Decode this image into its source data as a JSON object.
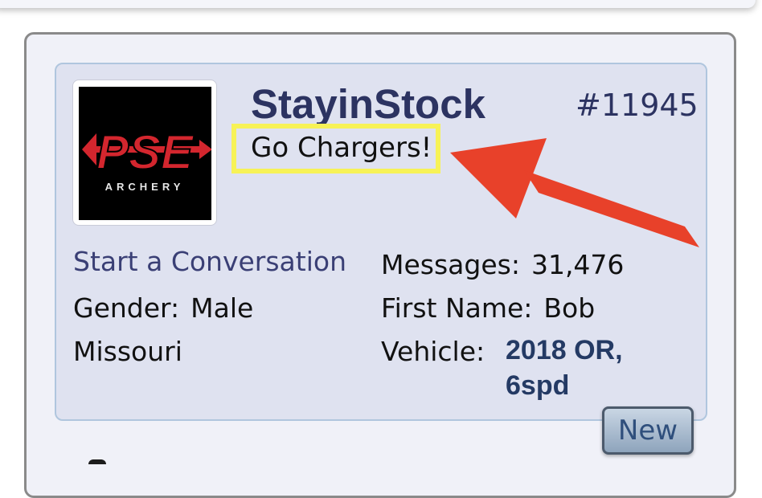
{
  "profile": {
    "username": "StayinStock",
    "user_number": "#11945",
    "status": "Go Chargers!",
    "start_conversation": "Start a Conversation",
    "gender_label": "Gender:",
    "gender_value": "Male",
    "location": "Missouri",
    "messages_label": "Messages:",
    "messages_value": "31,476",
    "first_name_label": "First Name:",
    "first_name_value": "Bob",
    "vehicle_label": "Vehicle:",
    "vehicle_value": "2018 OR, 6spd",
    "new_badge": "New"
  },
  "avatar": {
    "brand_text": "PSE",
    "sub_text": "ARCHERY",
    "brand_color": "#d3262e"
  },
  "colors": {
    "highlight_box": "#f7f257",
    "arrow": "#e8412a",
    "username": "#2c3361",
    "link": "#3a3f75"
  }
}
